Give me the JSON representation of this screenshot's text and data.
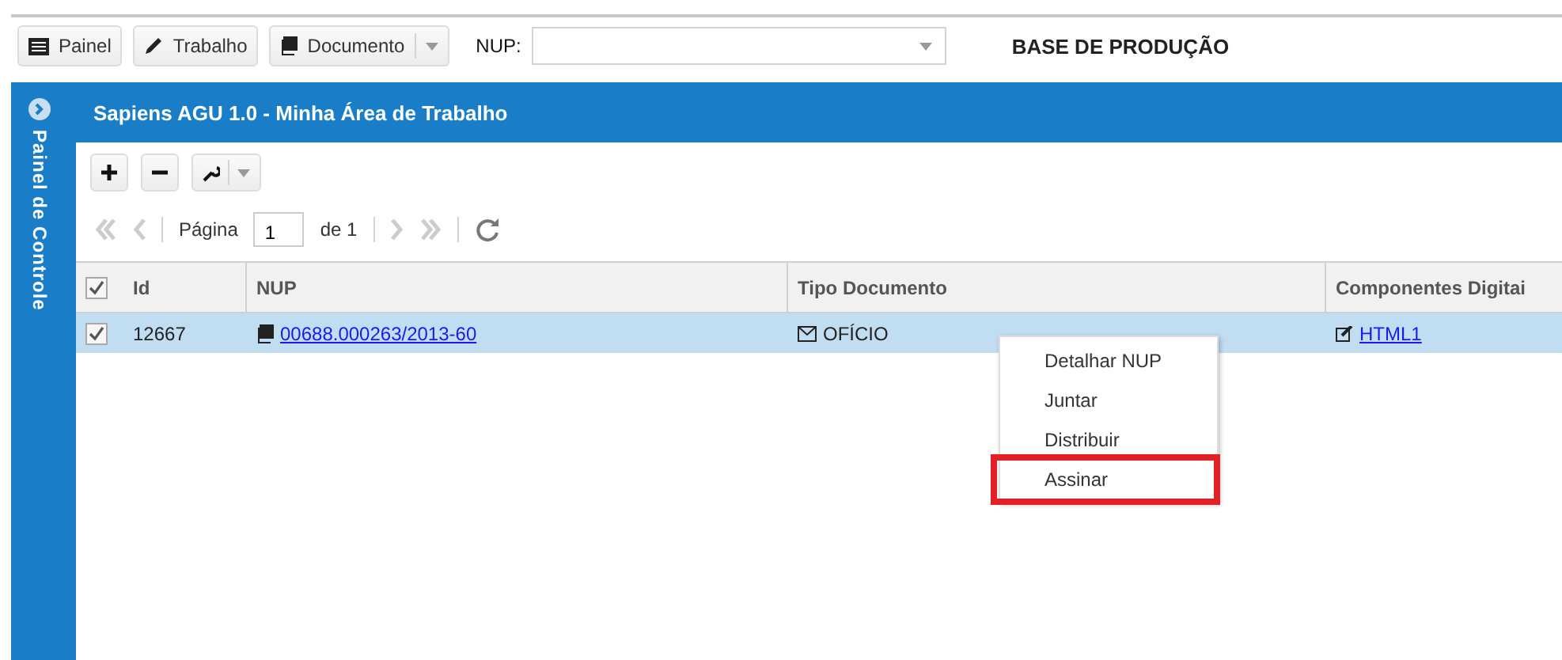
{
  "toolbar": {
    "buttons": [
      {
        "label": "Painel",
        "kind": "plain"
      },
      {
        "label": "Trabalho",
        "kind": "plain"
      },
      {
        "label": "Documento",
        "kind": "split"
      }
    ],
    "nup_label": "NUP:",
    "base_label": "BASE DE PRODUÇÃO"
  },
  "sidebar": {
    "title": "Painel de Controle"
  },
  "panel": {
    "title": "Sapiens AGU 1.0 - Minha Área de Trabalho"
  },
  "pager": {
    "page_label": "Página",
    "page_value": "1",
    "of_label": "de 1"
  },
  "table": {
    "all_checked": true,
    "columns": [
      "Id",
      "NUP",
      "Tipo Documento",
      "Componentes Digitai"
    ],
    "rows": [
      {
        "selected": true,
        "checked": true,
        "id": "12667",
        "nup": "00688.000263/2013-60",
        "tipo": "OFÍCIO",
        "componente": "HTML1"
      }
    ]
  },
  "context_menu": {
    "items": [
      {
        "label": "Detalhar NUP",
        "highlighted": false
      },
      {
        "label": "Juntar",
        "highlighted": false
      },
      {
        "label": "Distribuir",
        "highlighted": false
      },
      {
        "label": "Assinar",
        "highlighted": true
      }
    ]
  }
}
